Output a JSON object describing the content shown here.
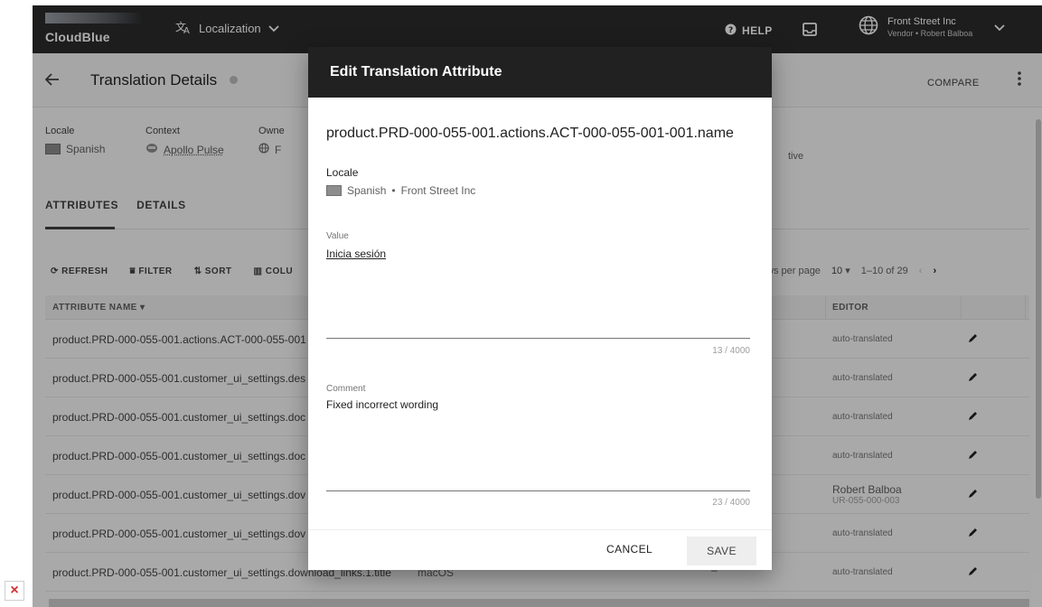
{
  "topbar": {
    "brand": "CloudBlue",
    "module_label": "Localization",
    "help_label": "HELP",
    "account_name": "Front Street Inc",
    "account_sub": "Vendor • Robert Balboa"
  },
  "header": {
    "title": "Translation Details",
    "compare_label": "COMPARE"
  },
  "meta": {
    "locale_label": "Locale",
    "locale_value": "Spanish",
    "context_label": "Context",
    "context_value": "Apollo Pulse",
    "owner_label": "Owne",
    "owner_value": "F",
    "status_value": "tive"
  },
  "tabs": {
    "attributes": "ATTRIBUTES",
    "details": "DETAILS"
  },
  "toolbar": {
    "refresh": "REFRESH",
    "filter": "FILTER",
    "sort": "SORT",
    "columns": "COLU",
    "rows_per_page_label": "ws per page",
    "rows_per_page_value": "10",
    "range": "1–10 of 29"
  },
  "table": {
    "col_name": "ATTRIBUTE NAME",
    "col_editor": "EDITOR",
    "rows": [
      {
        "name": "product.PRD-000-055-001.actions.ACT-000-055-001",
        "editor": "auto-translated"
      },
      {
        "name": "product.PRD-000-055-001.customer_ui_settings.des",
        "editor": "auto-translated"
      },
      {
        "name": "product.PRD-000-055-001.customer_ui_settings.doc",
        "editor": "auto-translated"
      },
      {
        "name": "product.PRD-000-055-001.customer_ui_settings.doc",
        "editor": "auto-translated"
      },
      {
        "name": "product.PRD-000-055-001.customer_ui_settings.dov",
        "editor_name": "Robert Balboa",
        "editor_id": "UR-055-000-003"
      },
      {
        "name": "product.PRD-000-055-001.customer_ui_settings.dov",
        "editor": "auto-translated"
      },
      {
        "name": "product.PRD-000-055-001.customer_ui_settings.download_links.1.title",
        "value": "macOS",
        "dash": "–",
        "editor": "auto-translated"
      }
    ]
  },
  "dialog": {
    "title": "Edit Translation Attribute",
    "attribute": "product.PRD-000-055-001.actions.ACT-000-055-001-001.name",
    "locale_label": "Locale",
    "locale_value": "Spanish",
    "locale_owner": "Front Street Inc",
    "value_label": "Value",
    "value_text": "Inicia sesión",
    "value_count": "13 / 4000",
    "comment_label": "Comment",
    "comment_text": "Fixed incorrect wording",
    "comment_count": "23 / 4000",
    "cancel_label": "CANCEL",
    "save_label": "SAVE"
  }
}
